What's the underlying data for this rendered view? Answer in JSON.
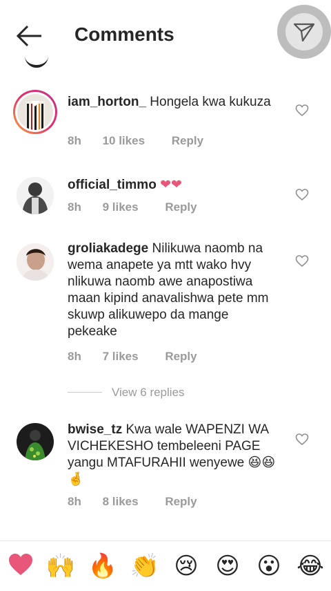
{
  "header": {
    "title": "Comments"
  },
  "comments": [
    {
      "username": "iam_horton_",
      "text": " Hongela kwa kukuza",
      "time": "8h",
      "likes": "10 likes",
      "reply": "Reply"
    },
    {
      "username": "official_timmo",
      "text": " ❤❤",
      "time": "8h",
      "likes": "9 likes",
      "reply": "Reply"
    },
    {
      "username": "groliakadege",
      "text": " Nilikuwa naomb na wema anapete ya mtt wako hvy nlikuwa naomb awe anapostiwa maan kipind anavalishwa pete mm skuwp alikuwepo da mange pekeake",
      "time": "8h",
      "likes": "7 likes",
      "reply": "Reply"
    },
    {
      "username": "bwise_tz",
      "text": " Kwa wale WAPENZI WA VICHEKESHO tembeleeni PAGE yangu MTAFURAHII wenyewe 😆😆🤞",
      "time": "8h",
      "likes": "8 likes",
      "reply": "Reply"
    }
  ],
  "view_replies": "View 6 replies",
  "emoji_bar": [
    "❤️",
    "🙌",
    "🔥",
    "👏",
    "😢",
    "😍",
    "😮",
    "😂"
  ],
  "colors": {
    "meta": "#9a9a9a",
    "text": "#262626",
    "heart": "#e8567a"
  }
}
